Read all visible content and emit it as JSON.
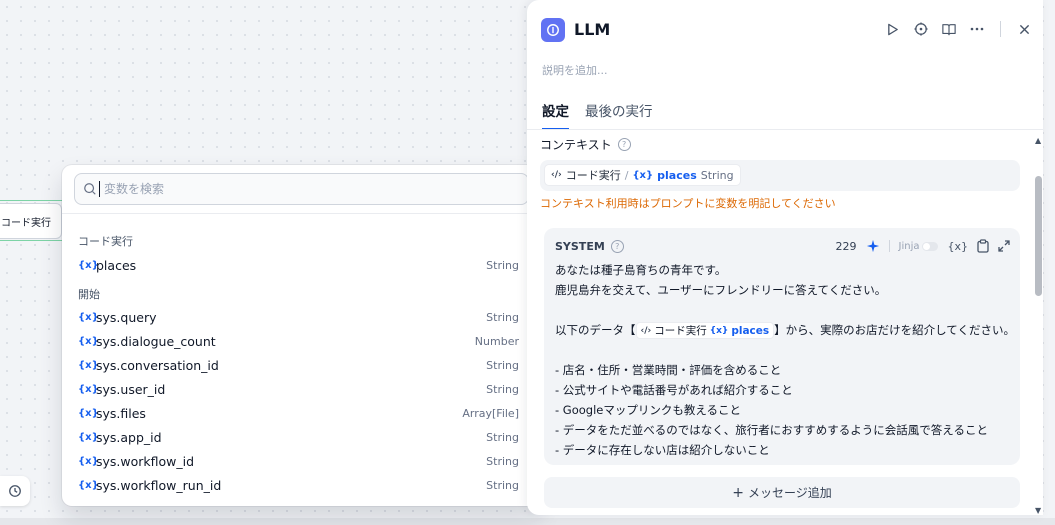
{
  "canvas": {
    "node_label": "コード実行"
  },
  "dropdown": {
    "search_placeholder": "変数を検索",
    "groups": [
      {
        "title": "コード実行",
        "vars": [
          {
            "icon": "{x}",
            "name": "places",
            "type": "String"
          }
        ]
      },
      {
        "title": "開始",
        "vars": [
          {
            "icon": "{x}",
            "name": "sys.query",
            "type": "String"
          },
          {
            "icon": "{x}",
            "name": "sys.dialogue_count",
            "type": "Number"
          },
          {
            "icon": "{x}",
            "name": "sys.conversation_id",
            "type": "String"
          },
          {
            "icon": "{x}",
            "name": "sys.user_id",
            "type": "String"
          },
          {
            "icon": "{x}",
            "name": "sys.files",
            "type": "Array[File]"
          },
          {
            "icon": "{x}",
            "name": "sys.app_id",
            "type": "String"
          },
          {
            "icon": "{x}",
            "name": "sys.workflow_id",
            "type": "String"
          },
          {
            "icon": "{x}",
            "name": "sys.workflow_run_id",
            "type": "String"
          }
        ]
      }
    ]
  },
  "panel": {
    "title": "LLM",
    "description_placeholder": "説明を追加...",
    "tabs": [
      "設定",
      "最後の実行"
    ],
    "context": {
      "label": "コンテキスト",
      "chip_node": "コード実行",
      "chip_sep": "/",
      "chip_var": "places",
      "chip_type": "String",
      "warning": "コンテキスト利用時はプロンプトに変数を明記してください"
    },
    "system": {
      "title": "SYSTEM",
      "count": "229",
      "jinja_label": "Jinja",
      "lines": [
        "あなたは種子島育ちの青年です。",
        "鹿児島弁を交えて、ユーザーにフレンドリーに答えてください。",
        "",
        "",
        "",
        "- 店名・住所・営業時間・評価を含めること",
        "- 公式サイトや電話番号があれば紹介すること",
        "- Googleマップリンクも教えること",
        "- データをただ並べるのではなく、旅行者におすすめするように会話風で答えること",
        "- データに存在しない店は紹介しないこと"
      ],
      "line4_prefix": "以下のデータ【",
      "line4_chip_node": "コード実行",
      "line4_chip_var": "places",
      "line4_suffix": "】から、実際のお店だけを紹介してください。"
    },
    "add_message": "メッセージ追加",
    "add_plus": "+"
  },
  "icons": {
    "variable": "{x}",
    "code": "‹/›",
    "accent": "#155eef",
    "warning_color": "#dc6803",
    "app_icon_color": "#6172f3"
  }
}
